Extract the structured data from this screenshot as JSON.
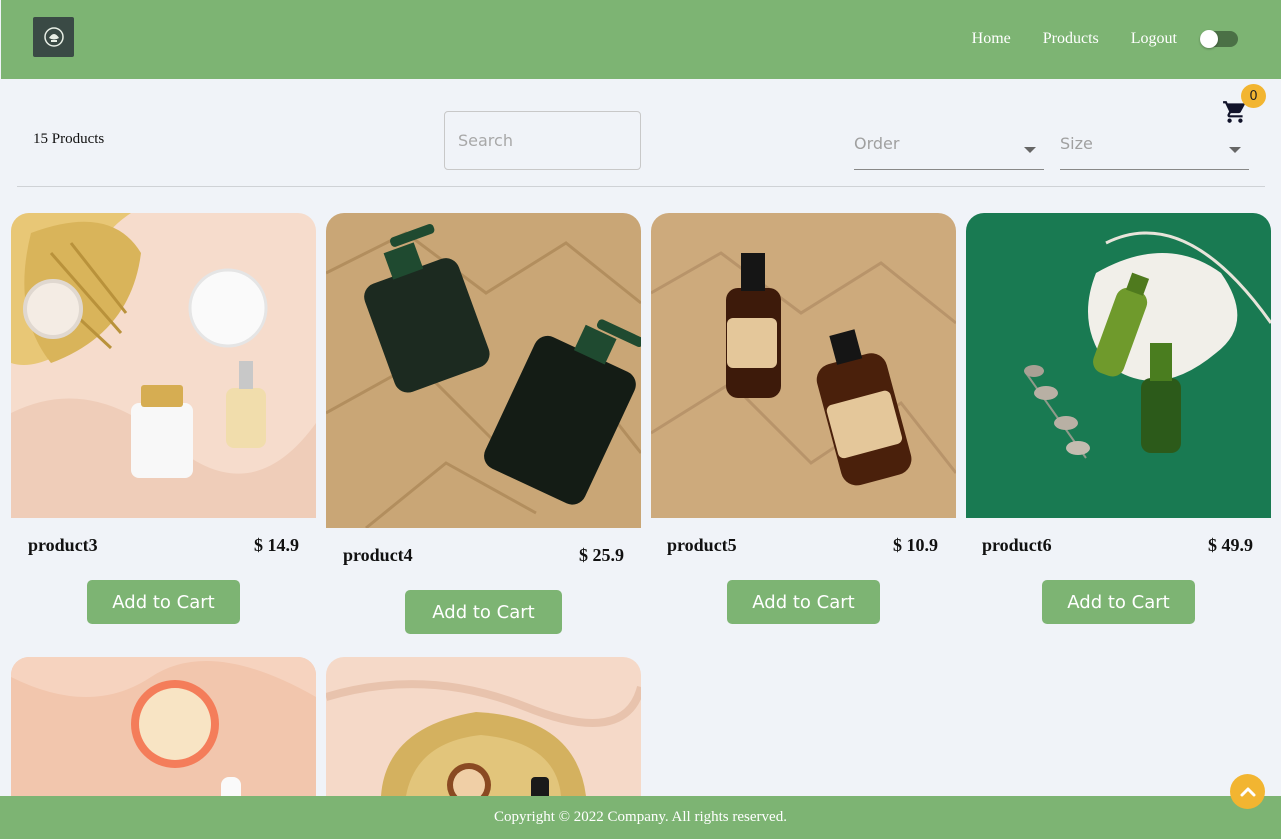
{
  "header": {
    "logo_icon": "leaf-icon",
    "nav": [
      "Home",
      "Products",
      "Logout"
    ],
    "theme_toggle": "off"
  },
  "toolbar": {
    "count_text": "15 Products",
    "search_placeholder": "Search",
    "order_label": "Order",
    "size_label": "Size",
    "cart_count": "0",
    "cart_icon": "cart-icon"
  },
  "products": [
    {
      "name": "product3",
      "price": "$ 14.9",
      "button": "Add to Cart"
    },
    {
      "name": "product4",
      "price": "$ 25.9",
      "button": "Add to Cart"
    },
    {
      "name": "product5",
      "price": "$ 10.9",
      "button": "Add to Cart"
    },
    {
      "name": "product6",
      "price": "$ 49.9",
      "button": "Add to Cart"
    }
  ],
  "footer": {
    "copyright": "Copyright © 2022 Company. All rights reserved."
  },
  "colors": {
    "brand": "#7db473",
    "accent": "#f2b531",
    "background": "#f0f3f8"
  }
}
